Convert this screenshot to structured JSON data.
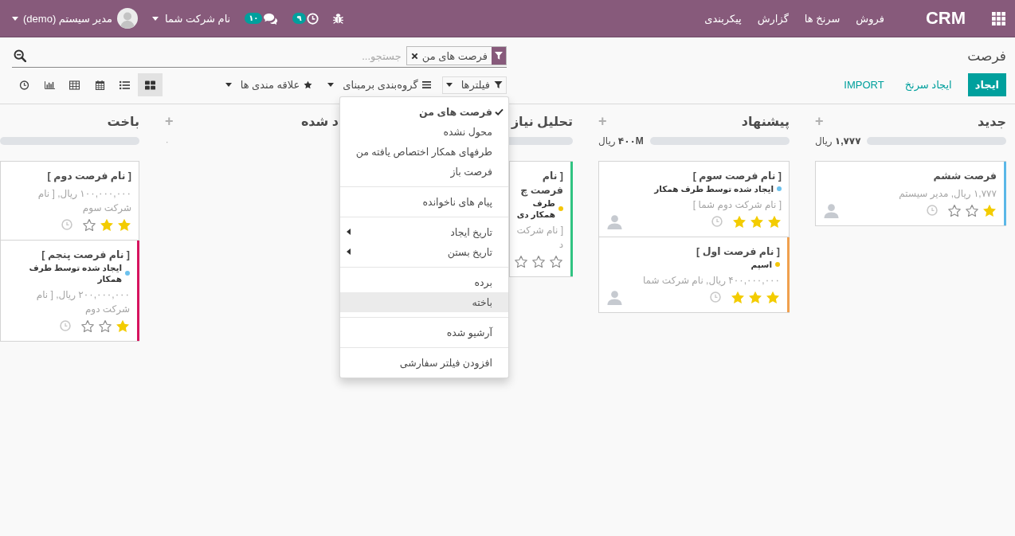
{
  "navbar": {
    "brand": "CRM",
    "menu": [
      "فروش",
      "سرنخ ها",
      "گزارش",
      "پیکربندی"
    ],
    "activity_count": "۹",
    "message_count": "۱۰",
    "company": "نام شرکت شما",
    "user": "مدیر سیستم (demo)"
  },
  "breadcrumb": "فرصت",
  "search": {
    "placeholder": "جستجو...",
    "facets": [
      {
        "label": "فرصت های من"
      }
    ]
  },
  "buttons": [
    {
      "label": "ایجاد",
      "kind": "primary"
    },
    {
      "label": "ایجاد سرنخ",
      "kind": "link"
    },
    {
      "label": "IMPORT",
      "kind": "link"
    }
  ],
  "search_menus": [
    {
      "label": "فیلترها",
      "kind": "filter",
      "expanded": true,
      "sections": [
        {
          "items": [
            {
              "label": "فرصت های من",
              "checked": true,
              "highlighted": false,
              "submenu": false
            },
            {
              "label": "محول نشده",
              "checked": false,
              "highlighted": false,
              "submenu": false
            },
            {
              "label": "طرفهای همکار اختصاص یافته من",
              "checked": false,
              "highlighted": false,
              "submenu": false
            },
            {
              "label": "فرصت باز",
              "checked": false,
              "highlighted": false,
              "submenu": false
            }
          ]
        },
        {
          "items": [
            {
              "label": "پیام های ناخوانده",
              "checked": false,
              "highlighted": false,
              "submenu": false
            }
          ]
        },
        {
          "items": [
            {
              "label": "تاریخ ایجاد",
              "checked": false,
              "highlighted": false,
              "submenu": true
            },
            {
              "label": "تاریخ بستن",
              "checked": false,
              "highlighted": false,
              "submenu": true
            }
          ]
        },
        {
          "items": [
            {
              "label": "برده",
              "checked": false,
              "highlighted": false,
              "submenu": false
            },
            {
              "label": "باخته",
              "checked": false,
              "highlighted": true,
              "submenu": false
            }
          ]
        },
        {
          "items": [
            {
              "label": "آرشیو شده",
              "checked": false,
              "highlighted": false,
              "submenu": false
            }
          ]
        },
        {
          "items": [
            {
              "label": "افزودن فیلتر سفارشی",
              "checked": false,
              "highlighted": false,
              "submenu": false
            }
          ]
        }
      ]
    },
    {
      "label": "گروه‌بندی برمبنای",
      "kind": "groupby",
      "expanded": false
    },
    {
      "label": "علاقه مندی ها",
      "kind": "favorite",
      "expanded": false
    }
  ],
  "views": [
    {
      "kind": "kanban",
      "selected": true
    },
    {
      "kind": "list",
      "selected": false
    },
    {
      "kind": "calendar",
      "selected": false
    },
    {
      "kind": "pivot",
      "selected": false
    },
    {
      "kind": "graph",
      "selected": false
    },
    {
      "kind": "activity",
      "selected": false
    }
  ],
  "columns": [
    {
      "title": "جدید",
      "add": "+",
      "amount": "**۱,۷۷۷** ریال",
      "progress": {
        "level": 0
      },
      "cards": [
        {
          "title": "فرصت ششم",
          "subtitle": "۱,۷۷۷ ریال, مدیر سیستم",
          "stars": 1,
          "activity": true,
          "avatar": true,
          "color": "#5bb8e8"
        }
      ]
    },
    {
      "title": "پیشنهاد",
      "add": "+",
      "amount": "**۴۰۰M** ریال",
      "progress": {
        "level": 0
      },
      "cards": [
        {
          "title": "[ نام فرصت سوم ]",
          "tag": {
            "label": "ایجاد شده توسط طرف همکار",
            "color": "#6cc1ed"
          },
          "subtitle": "[ نام شرکت دوم شما ]",
          "stars": 3,
          "activity": true,
          "avatar": true
        },
        {
          "title": "[ نام فرصت اول ]",
          "tag": {
            "label": "اسپم",
            "color": "#f4c609"
          },
          "subtitle": "۴۰۰,۰۰۰,۰۰۰ ریال, نام شرکت شما",
          "stars": 3,
          "activity": true,
          "avatar": true,
          "color": "#f0a04e"
        }
      ]
    },
    {
      "title": "تحلیل نیاز",
      "progress": {
        "level": 0
      },
      "cards": [
        {
          "title": "[ نام فرصت چ",
          "tag": {
            "label": "طرف همکار دی",
            "color": "#f4c609"
          },
          "subtitle": "[ نام شرکت د",
          "stars": 0,
          "activity": false,
          "avatar": false,
          "color": "#30c381"
        }
      ]
    },
    {
      "title": "د شده",
      "add": "+",
      "amount": "۰"
    },
    {
      "title": "باخت",
      "progress": {
        "level": 0
      },
      "cards": [
        {
          "title": "[ نام فرصت دوم ]",
          "subtitle": "۱۰۰,۰۰۰,۰۰۰ ریال, [ نام شرکت سوم",
          "stars": 2,
          "activity": true,
          "avatar": false
        },
        {
          "title": "[ نام فرصت پنجم ]",
          "tag": {
            "label": "ایجاد شده توسط طرف همکار",
            "color": "#6cc1ed"
          },
          "subtitle": "۲۰۰,۰۰۰,۰۰۰ ریال, [ نام شرکت دوم",
          "stars": 1,
          "activity": true,
          "avatar": false,
          "color": "#d6145f"
        }
      ]
    }
  ]
}
